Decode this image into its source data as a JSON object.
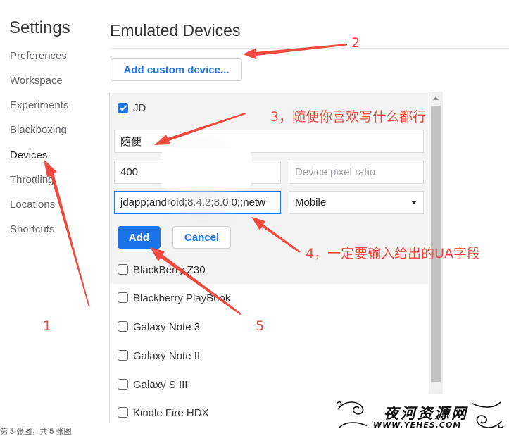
{
  "sidebar": {
    "title": "Settings",
    "items": [
      {
        "label": "Preferences"
      },
      {
        "label": "Workspace"
      },
      {
        "label": "Experiments"
      },
      {
        "label": "Blackboxing"
      },
      {
        "label": "Devices"
      },
      {
        "label": "Throttling"
      },
      {
        "label": "Locations"
      },
      {
        "label": "Shortcuts"
      }
    ],
    "active": "Devices"
  },
  "main": {
    "title": "Emulated Devices",
    "add_custom_label": "Add custom device..."
  },
  "editor": {
    "device_label": "JD",
    "device_checked": true,
    "name_value": "随便",
    "width_value": "400",
    "pixel_ratio_placeholder": "Device pixel ratio",
    "ua_value": "jdapp;android;8.4.2;8.0.0;;netw",
    "type_value": "Mobile",
    "add_label": "Add",
    "cancel_label": "Cancel"
  },
  "devices": [
    {
      "label": "BlackBerry Z30",
      "checked": false
    },
    {
      "label": "Blackberry PlayBook",
      "checked": false
    },
    {
      "label": "Galaxy Note 3",
      "checked": false
    },
    {
      "label": "Galaxy Note II",
      "checked": false
    },
    {
      "label": "Galaxy S III",
      "checked": false
    },
    {
      "label": "Kindle Fire HDX",
      "checked": false
    }
  ],
  "annotations": {
    "a1": "1",
    "a2": "2",
    "a3": "3，随便你喜欢写什么都行",
    "a4": "4，一定要输入给出的UA字段",
    "a5": "5"
  },
  "footer": {
    "caption": "第 3 张图，共 5 张图"
  },
  "watermark": {
    "name": "夜河资源网",
    "url": "WWW.YEHES.COM"
  },
  "colors": {
    "accent": "#1a73e8",
    "annotation": "#f04a3e"
  }
}
